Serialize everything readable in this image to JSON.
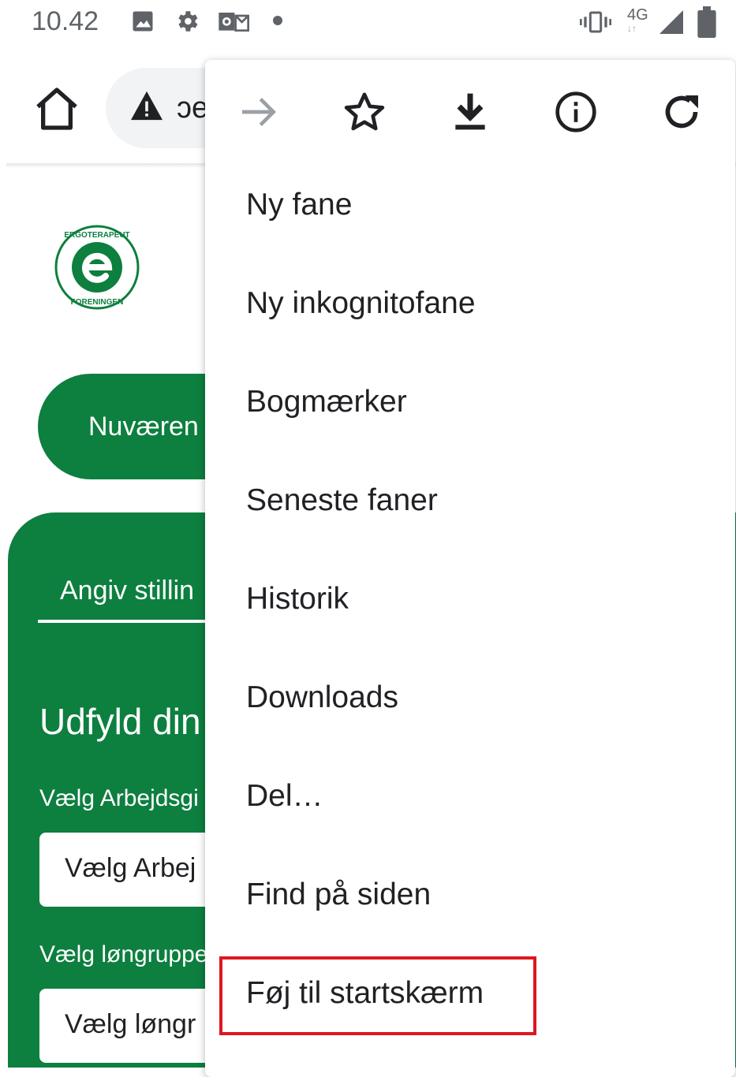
{
  "status_bar": {
    "time": "10.42",
    "network": "4G",
    "icons": [
      "image-icon",
      "settings-gear-icon",
      "outlook-icon",
      "notification-dot-icon",
      "vibrate-icon",
      "network-4g-icon",
      "signal-icon",
      "battery-icon"
    ]
  },
  "toolbar": {
    "url_partial": "ɔe",
    "icons": [
      "home-icon",
      "warning-icon"
    ]
  },
  "page": {
    "current_button_partial": "Nuværen",
    "tab_partial": "Angiv stillin",
    "heading_partial": "Udfyld din",
    "employer_label_partial": "Vælg Arbejdsgi",
    "employer_select_partial": "Vælg Arbej",
    "salary_label_partial": "Vælg løngruppe",
    "salary_select_partial": "Vælg løngr",
    "brand_color": "#0d7f3f",
    "logo_text": "ERGOTERAPEUT FORENINGEN"
  },
  "menu": {
    "icons": [
      "forward-arrow-icon",
      "bookmark-star-icon",
      "download-icon",
      "info-icon",
      "refresh-icon"
    ],
    "items": [
      "Ny fane",
      "Ny inkognitofane",
      "Bogmærker",
      "Seneste faner",
      "Historik",
      "Downloads",
      "Del…",
      "Find på siden",
      "Føj til startskærm"
    ],
    "highlight_color": "#e0161f"
  }
}
